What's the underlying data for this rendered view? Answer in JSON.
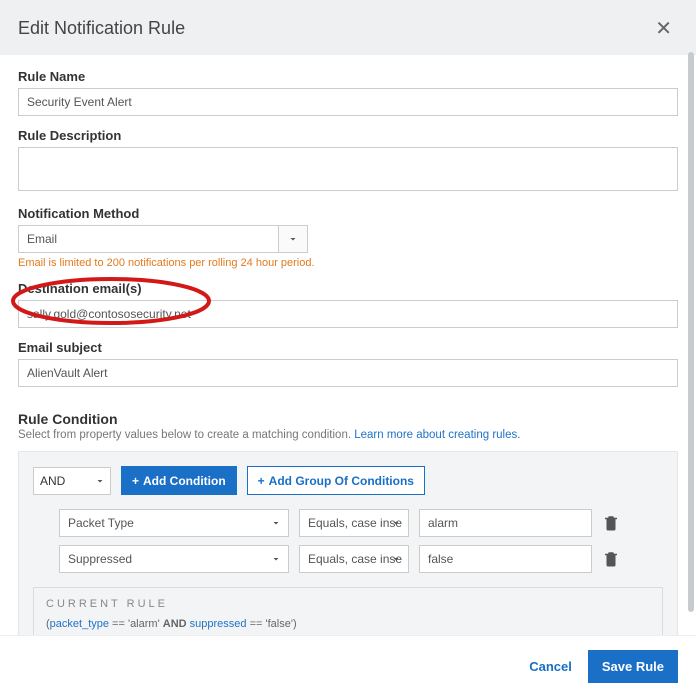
{
  "header": {
    "title": "Edit Notification Rule"
  },
  "form": {
    "rule_name": {
      "label": "Rule Name",
      "value": "Security Event Alert"
    },
    "rule_description": {
      "label": "Rule Description",
      "value": ""
    },
    "notification_method": {
      "label": "Notification Method",
      "value": "Email",
      "hint": "Email is limited to 200 notifications per rolling 24 hour period."
    },
    "destination_emails": {
      "label": "Destination email(s)",
      "value": "sally.gold@contososecurity.net"
    },
    "email_subject": {
      "label": "Email subject",
      "value": "AlienVault Alert"
    }
  },
  "rule_condition": {
    "title": "Rule Condition",
    "subtitle_prefix": "Select from property values below to create a matching condition. ",
    "subtitle_link": "Learn more about creating rules.",
    "group_operator": "AND",
    "buttons": {
      "add_condition": "Add Condition",
      "add_group": "Add Group Of Conditions"
    },
    "rows": [
      {
        "property": "Packet Type",
        "operator": "Equals, case inse",
        "value": "alarm"
      },
      {
        "property": "Suppressed",
        "operator": "Equals, case inse",
        "value": "false"
      }
    ],
    "current_rule_label": "CURRENT RULE",
    "expr": {
      "p1": "packet_type",
      "v1": "'alarm'",
      "op": "AND",
      "p2": "suppressed",
      "v2": "'false'"
    }
  },
  "footer": {
    "cancel": "Cancel",
    "save": "Save Rule"
  }
}
